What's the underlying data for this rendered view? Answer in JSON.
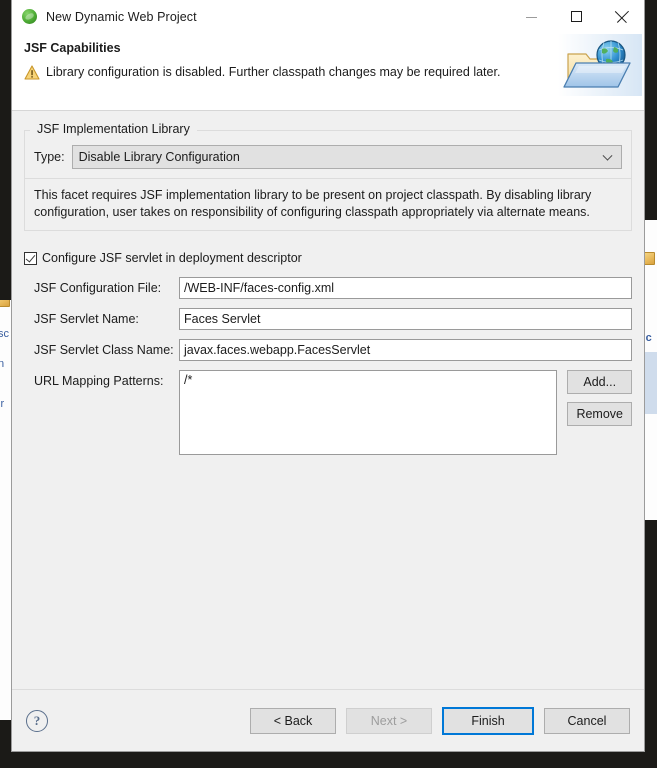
{
  "window": {
    "title": "New Dynamic Web Project",
    "app_icon": "eclipse-leaf-icon",
    "controls": {
      "minimize": "minimize-icon",
      "maximize": "maximize-icon",
      "close": "close-icon"
    }
  },
  "header": {
    "title": "JSF Capabilities",
    "warning_icon": "warning-triangle-icon",
    "message": "Library configuration is disabled. Further classpath changes may be required later.",
    "banner_icon": "web-project-folder-globe-icon"
  },
  "group": {
    "legend": "JSF Implementation Library",
    "type_label": "Type:",
    "type_value": "Disable Library Configuration",
    "dropdown_icon": "chevron-down-icon",
    "description": "This facet requires JSF implementation library to be present on project classpath. By disabling library configuration, user takes on responsibility of configuring classpath appropriately via alternate means."
  },
  "servlet": {
    "checkbox_label": "Configure JSF servlet in deployment descriptor",
    "checkbox_checked": true,
    "fields": [
      {
        "label": "JSF Configuration File:",
        "value": "/WEB-INF/faces-config.xml"
      },
      {
        "label": "JSF Servlet Name:",
        "value": "Faces Servlet"
      },
      {
        "label": "JSF Servlet Class Name:",
        "value": "javax.faces.webapp.FacesServlet"
      }
    ],
    "url_label": "URL Mapping Patterns:",
    "url_patterns": "/*",
    "add_label": "Add...",
    "remove_label": "Remove"
  },
  "footer": {
    "help_glyph": "?",
    "back_label": "< Back",
    "next_label": "Next >",
    "next_disabled": true,
    "finish_label": "Finish",
    "cancel_label": "Cancel"
  },
  "colors": {
    "accent": "#0078d7",
    "dialog_bg": "#f0f0f0",
    "field_bg": "#ffffff",
    "warning": "#e8b93c",
    "desktop": "#1b1a17"
  },
  "background": {
    "left_fragments": [
      "sc",
      "n",
      "ir"
    ],
    "right_fragment": ":c"
  }
}
